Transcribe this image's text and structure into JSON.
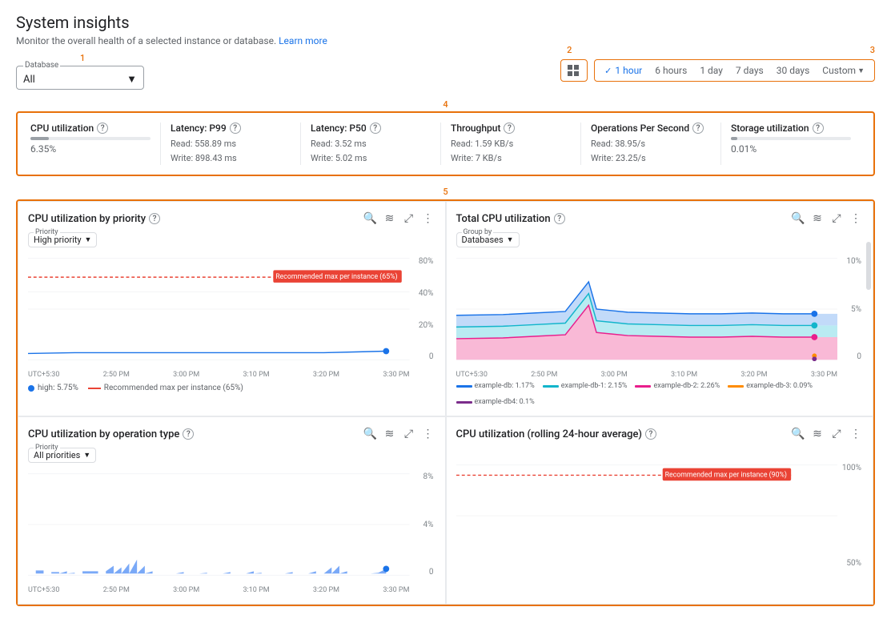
{
  "page": {
    "title": "System insights",
    "subtitle": "Monitor the overall health of a selected instance or database.",
    "learn_more": "Learn more"
  },
  "numbers": {
    "n1": "1",
    "n2": "2",
    "n3": "3",
    "n4": "4",
    "n5": "5"
  },
  "database_selector": {
    "label": "Database",
    "value": "All"
  },
  "time_options": [
    {
      "label": "1 hour",
      "active": true
    },
    {
      "label": "6 hours",
      "active": false
    },
    {
      "label": "1 day",
      "active": false
    },
    {
      "label": "7 days",
      "active": false
    },
    {
      "label": "30 days",
      "active": false
    },
    {
      "label": "Custom",
      "active": false
    }
  ],
  "metrics": [
    {
      "title": "CPU utilization",
      "bar_pct": 15,
      "value": "6.35%",
      "sub": ""
    },
    {
      "title": "Latency: P99",
      "bar_pct": 0,
      "sub_lines": [
        "Read: 558.89 ms",
        "Write: 898.43 ms"
      ]
    },
    {
      "title": "Latency: P50",
      "bar_pct": 0,
      "sub_lines": [
        "Read: 3.52 ms",
        "Write: 5.02 ms"
      ]
    },
    {
      "title": "Throughput",
      "bar_pct": 0,
      "sub_lines": [
        "Read: 1.59 KB/s",
        "Write: 7 KB/s"
      ]
    },
    {
      "title": "Operations Per Second",
      "bar_pct": 0,
      "sub_lines": [
        "Read: 38.95/s",
        "Write: 23.25/s"
      ]
    },
    {
      "title": "Storage utilization",
      "bar_pct": 5,
      "value": "0.01%",
      "sub": ""
    }
  ],
  "charts": [
    {
      "id": "cpu-by-priority",
      "title": "CPU utilization by priority",
      "priority_label": "Priority",
      "priority_value": "High priority",
      "y_labels": [
        "80%",
        "40%",
        "20%",
        "0"
      ],
      "x_labels": [
        "UTC+5:30",
        "2:50 PM",
        "3:00 PM",
        "3:10 PM",
        "3:20 PM",
        "3:30 PM"
      ],
      "legend": [
        {
          "type": "dot",
          "color": "#1a73e8",
          "label": "high: 5.75%"
        },
        {
          "type": "dash-red",
          "label": "Recommended max per instance (65%)"
        }
      ],
      "recommended_label": "Recommended max per instance (65%)"
    },
    {
      "id": "total-cpu",
      "title": "Total CPU utilization",
      "group_by_label": "Group by",
      "group_by_value": "Databases",
      "y_labels": [
        "10%",
        "5%",
        "0"
      ],
      "x_labels": [
        "UTC+5:30",
        "2:50 PM",
        "3:00 PM",
        "3:10 PM",
        "3:20 PM",
        "3:30 PM"
      ],
      "legend": [
        {
          "color": "#1a73e8",
          "label": "example-db: 1.17%"
        },
        {
          "color": "#12b5cb",
          "label": "example-db-1: 2.15%"
        },
        {
          "color": "#e91e8c",
          "label": "example-db-2: 2.26%"
        },
        {
          "color": "#ff8c00",
          "label": "example-db-3: 0.09%"
        },
        {
          "color": "#7b2d8b",
          "label": "example-db4: 0.1%"
        }
      ]
    },
    {
      "id": "cpu-by-operation",
      "title": "CPU utilization by operation type",
      "priority_label": "Priority",
      "priority_value": "All priorities",
      "y_labels": [
        "8%",
        "4%",
        "0"
      ],
      "x_labels": [
        "UTC+5:30",
        "2:50 PM",
        "3:00 PM",
        "3:10 PM",
        "3:20 PM",
        "3:30 PM"
      ]
    },
    {
      "id": "cpu-rolling",
      "title": "CPU utilization (rolling 24-hour average)",
      "y_labels": [
        "100%",
        "50%"
      ],
      "x_labels": [],
      "recommended_label": "Recommended max per instance (90%)"
    }
  ]
}
